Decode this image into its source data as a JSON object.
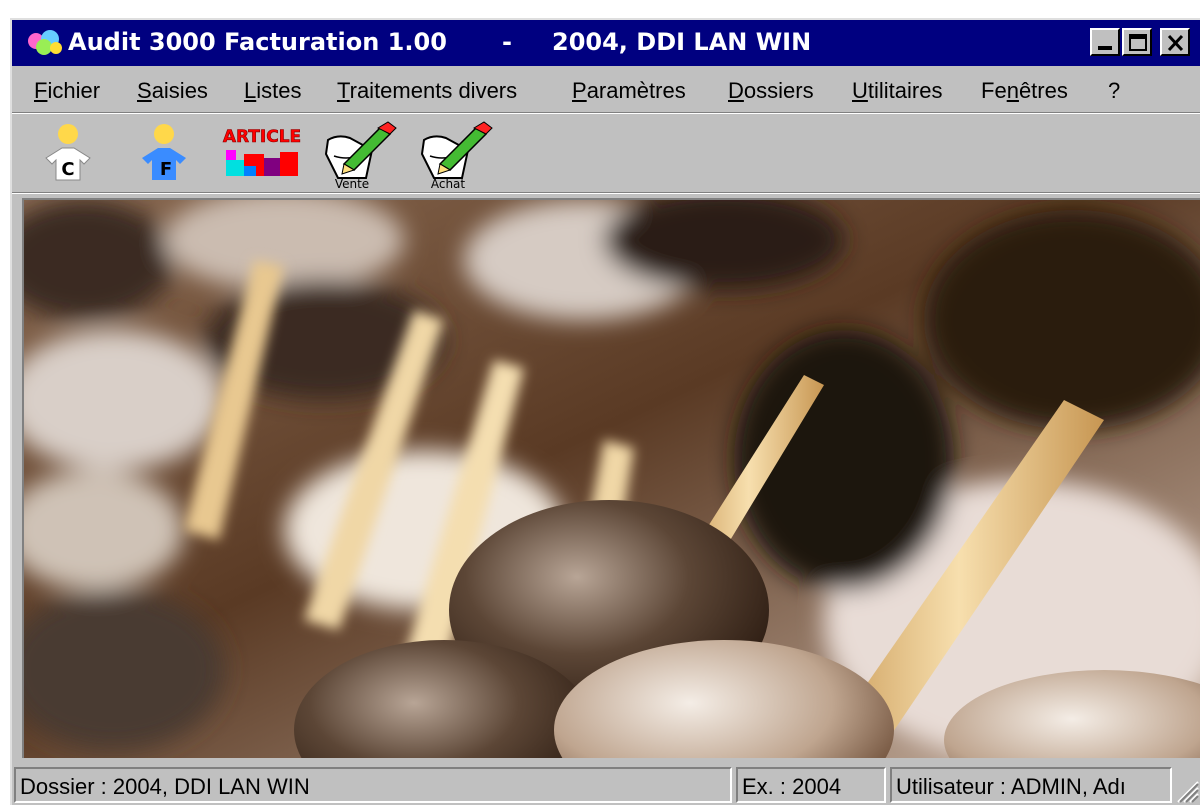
{
  "window": {
    "title_app": "Audit 3000 Facturation 1.00",
    "title_separator": "-",
    "title_document": "2004, DDI LAN WIN"
  },
  "menu": [
    {
      "mnemonic": "F",
      "rest": "ichier"
    },
    {
      "mnemonic": "S",
      "rest": "aisies"
    },
    {
      "mnemonic": "L",
      "rest": "istes"
    },
    {
      "mnemonic": "T",
      "rest": "raitements divers"
    },
    {
      "mnemonic": "P",
      "rest": "aramètres"
    },
    {
      "mnemonic": "D",
      "rest": "ossiers"
    },
    {
      "mnemonic": "U",
      "rest": "tilitaires"
    },
    {
      "pre": "Fe",
      "mnemonic": "n",
      "rest": "êtres"
    },
    {
      "mnemonic": "",
      "rest": "?"
    }
  ],
  "toolbar": {
    "client": {
      "icon": "client-person-icon",
      "letter": "C"
    },
    "supplier": {
      "icon": "supplier-person-icon",
      "letter": "F"
    },
    "article": {
      "icon": "article-icon",
      "label": "ARTICLE"
    },
    "sale": {
      "icon": "sale-pen-icon",
      "label": "Vente"
    },
    "purchase": {
      "icon": "purchase-pen-icon",
      "label": "Achat"
    }
  },
  "background": {
    "icon": "abacus-background-image"
  },
  "statusbar": {
    "dossier": "Dossier : 2004, DDI LAN WIN",
    "exercice": "Ex. : 2004",
    "user": "Utilisateur : ADMIN, Adı"
  },
  "colors": {
    "titlebar": "#000080",
    "window_face": "#c0c0c0",
    "client_yellow": "#ffd84a",
    "supplier_blue": "#3a8cff"
  }
}
